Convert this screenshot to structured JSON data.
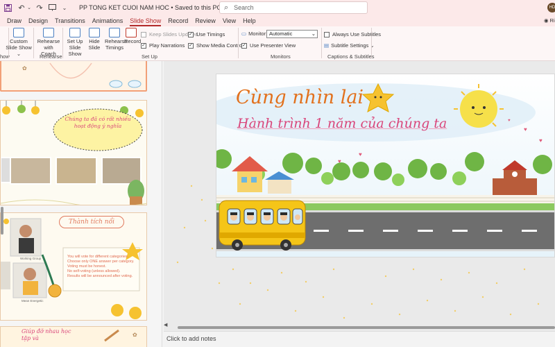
{
  "window": {
    "title": "PP TONG KET CUOI NAM HOC • Saved to this PC ⌄",
    "search_placeholder": "Search",
    "avatar_initials": "HD"
  },
  "tabs": [
    "Draw",
    "Design",
    "Transitions",
    "Animations",
    "Slide Show",
    "Record",
    "Review",
    "View",
    "Help"
  ],
  "active_tab": "Slide Show",
  "ribbon": {
    "custom_slide_show": "Custom Slide Show ⌄",
    "rehearse_with_coach": "Rehearse with Coach",
    "rehearse_group": "Rehearse",
    "set_up_slide_show": "Set Up Slide Show",
    "hide_slide": "Hide Slide",
    "rehearse_timings": "Rehearse Timings",
    "record": "Record",
    "keep_slides_updated": "Keep Slides Updated",
    "play_narrations": "Play Narrations",
    "use_timings": "Use Timings",
    "show_media_controls": "Show Media Controls",
    "set_up_group": "Set Up",
    "monitor_label": "Monitor:",
    "monitor_value": "Automatic",
    "use_presenter_view": "Use Presenter View",
    "monitors_group": "Monitors",
    "always_use_subtitles": "Always Use Subtitles",
    "subtitle_settings": "Subtitle Settings ⌄",
    "captions_group": "Captions & Subtitles",
    "start_group_fragment": "how",
    "right_edge": "Ri"
  },
  "thumbnails": {
    "slide2_cloud_text": "Chúng ta đã có rất nhiều hoạt động ý nghĩa",
    "slide3_title": "Thành tích nổi",
    "slide3_bullets": [
      "You will vote for different categories.",
      "Choose only ONE answer per category.",
      "Voting must be honest.",
      "No self-voting (unless allowed).",
      "Results will be announced after voting."
    ],
    "slide3_caption1": "Working Group",
    "slide3_caption2": "Mean Energetic",
    "slide4_title": "Giúp đỡ nhau học tập và"
  },
  "main_slide": {
    "title_line1": "Cùng nhìn lại",
    "title_line2": "Hành trình 1 năm của chúng ta"
  },
  "notes_placeholder": "Click to add notes",
  "colors": {
    "title_bar": "#fce9e9",
    "accent_red": "#b22a2a",
    "title_orange": "#e2711d",
    "title_pink": "#d9457a",
    "bus_yellow": "#f5c518",
    "road": "#6e6e6e"
  }
}
